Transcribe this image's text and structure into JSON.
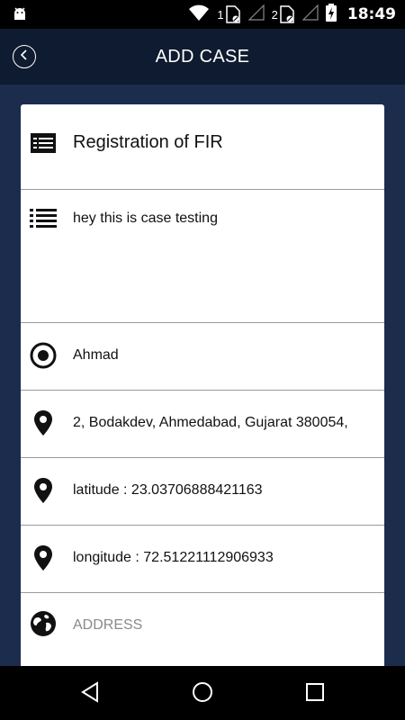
{
  "status_bar": {
    "sim1_label": "1",
    "sim2_label": "2",
    "time": "18:49"
  },
  "header": {
    "title": "ADD CASE"
  },
  "form": {
    "fields": [
      {
        "icon": "id-card-icon",
        "value": "Registration of FIR"
      },
      {
        "icon": "list-icon",
        "value": "hey this is case testing"
      },
      {
        "icon": "target-icon",
        "value": "Ahmad"
      },
      {
        "icon": "location-pin-icon",
        "value": "2, Bodakdev, Ahmedabad, Gujarat 380054,"
      },
      {
        "icon": "location-pin-icon",
        "value": "latitude : 23.03706888421163"
      },
      {
        "icon": "location-pin-icon",
        "value": "longitude : 72.51221112906933"
      },
      {
        "icon": "globe-icon",
        "placeholder": "ADDRESS"
      }
    ]
  },
  "colors": {
    "background": "#1b2c4d",
    "app_bar": "#0f1b30",
    "placeholder": "#8a8a8a"
  }
}
